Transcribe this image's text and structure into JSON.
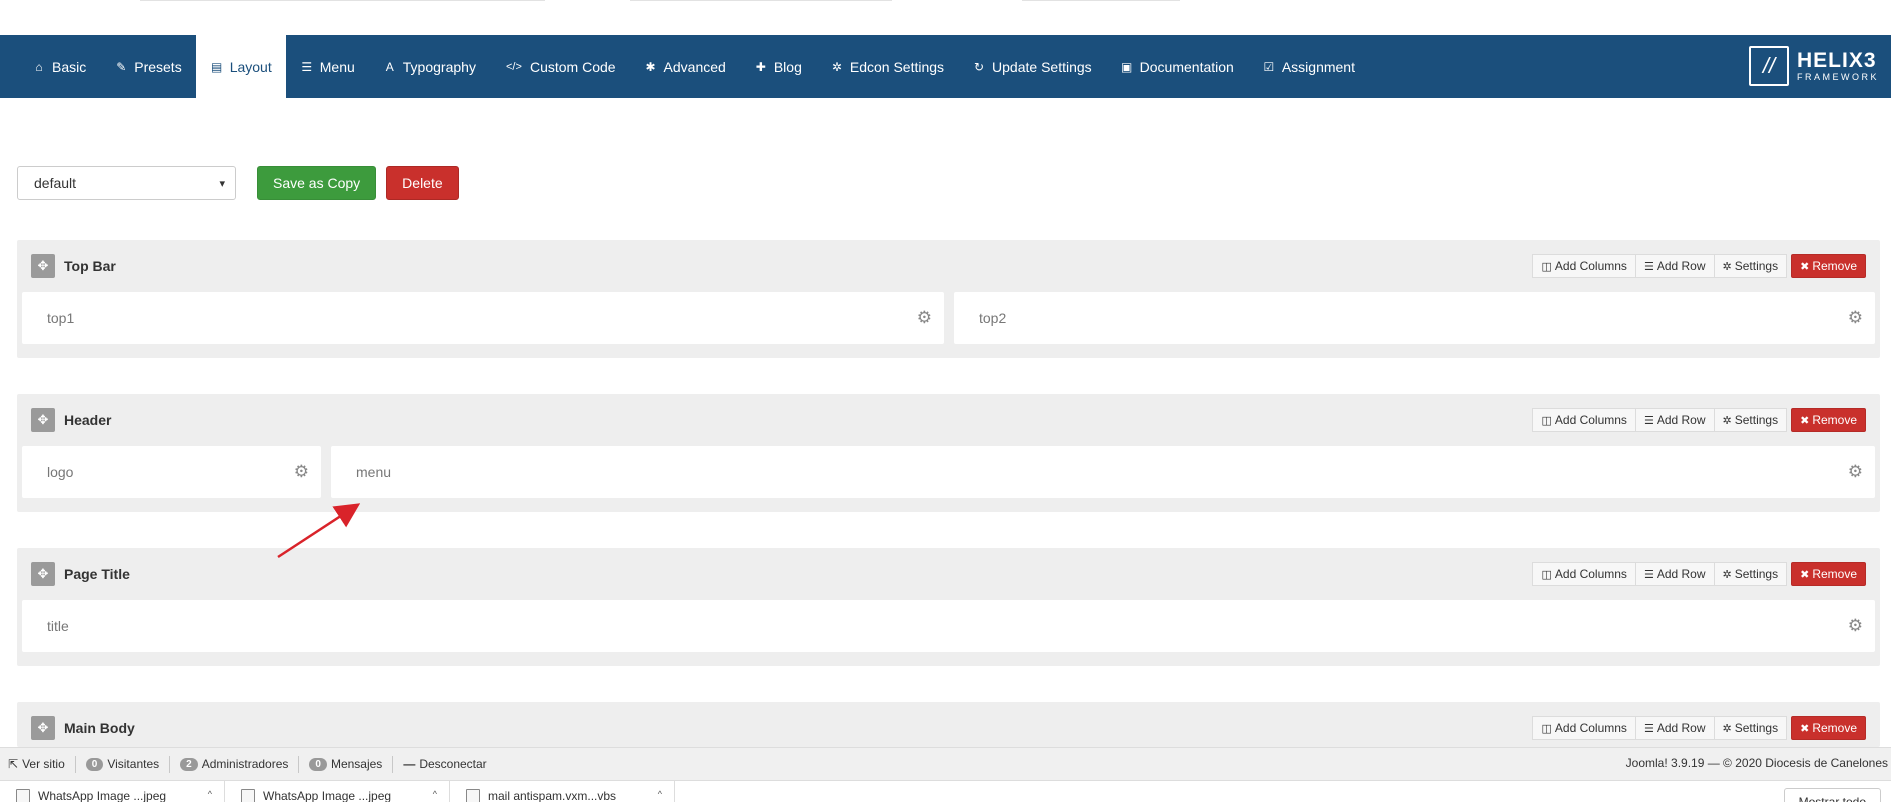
{
  "nav": {
    "tabs": [
      {
        "label": "Basic",
        "icon": "home-icon",
        "glyph": "⌂"
      },
      {
        "label": "Presets",
        "icon": "brush-icon",
        "glyph": "✎"
      },
      {
        "label": "Layout",
        "icon": "layout-icon",
        "glyph": "▤"
      },
      {
        "label": "Menu",
        "icon": "list-icon",
        "glyph": "☰"
      },
      {
        "label": "Typography",
        "icon": "font-icon",
        "glyph": "A"
      },
      {
        "label": "Custom Code",
        "icon": "code-icon",
        "glyph": "</>"
      },
      {
        "label": "Advanced",
        "icon": "cog-icon",
        "glyph": "✱"
      },
      {
        "label": "Blog",
        "icon": "pin-icon",
        "glyph": "✚"
      },
      {
        "label": "Edcon Settings",
        "icon": "cogs-icon",
        "glyph": "✲"
      },
      {
        "label": "Update Settings",
        "icon": "refresh-icon",
        "glyph": "↻"
      },
      {
        "label": "Documentation",
        "icon": "book-icon",
        "glyph": "▣"
      },
      {
        "label": "Assignment",
        "icon": "check-square-icon",
        "glyph": "☑"
      }
    ],
    "active_tab": "Layout",
    "brand": {
      "title": "HELIX3",
      "subtitle": "FRAMEWORK",
      "mark": "//"
    }
  },
  "toolbar": {
    "layout_select_value": "default",
    "save_copy_label": "Save as Copy",
    "delete_label": "Delete"
  },
  "row_actions": {
    "add_columns": "Add Columns",
    "add_row": "Add Row",
    "settings": "Settings",
    "remove": "Remove"
  },
  "sections": [
    {
      "title": "Top Bar",
      "columns": [
        "top1",
        "top2"
      ]
    },
    {
      "title": "Header",
      "columns": [
        "logo",
        "menu"
      ]
    },
    {
      "title": "Page Title",
      "columns": [
        "title"
      ]
    },
    {
      "title": "Main Body",
      "columns": []
    }
  ],
  "status_bar": {
    "view_site": "Ver sitio",
    "visitors_count": "0",
    "visitors_label": "Visitantes",
    "admins_count": "2",
    "admins_label": "Administradores",
    "messages_count": "0",
    "messages_label": "Mensajes",
    "logout": "Desconectar",
    "version": "Joomla! 3.9.19 — © 2020 Diocesis de Canelones"
  },
  "downloads": {
    "items": [
      "WhatsApp Image ...jpeg",
      "WhatsApp Image ...jpeg",
      "mail antispam.vxm...vbs"
    ],
    "show_all": "Mostrar todo"
  },
  "colors": {
    "navbar": "#1b4f7c",
    "green": "#3d9b3d",
    "red": "#c9302c",
    "section_bg": "#eeeeee",
    "arrow": "#d9232a"
  }
}
